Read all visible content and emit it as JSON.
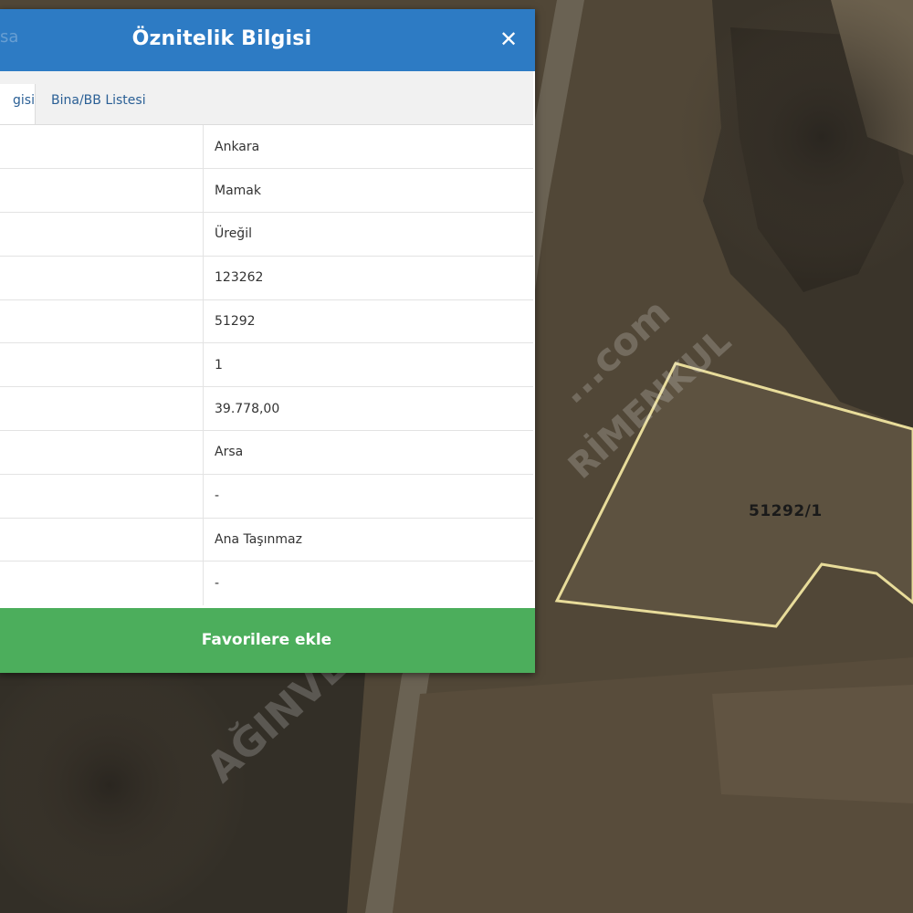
{
  "dialog": {
    "title": "Öznitelik Bilgisi",
    "header_ghost_text": "sa",
    "close_symbol": "✕",
    "tabs": [
      {
        "label": "gisi",
        "active": true
      },
      {
        "label": "Bina/BB Listesi",
        "active": false
      }
    ],
    "rows": [
      {
        "key": "",
        "value": "Ankara"
      },
      {
        "key": "",
        "value": "Mamak"
      },
      {
        "key": "",
        "value": "Üreğil"
      },
      {
        "key": "",
        "value": "123262"
      },
      {
        "key": "",
        "value": "51292"
      },
      {
        "key": "",
        "value": "1"
      },
      {
        "key": "",
        "value": "39.778,00"
      },
      {
        "key": "",
        "value": "Arsa"
      },
      {
        "key": "",
        "value": "-"
      },
      {
        "key": "",
        "value": "Ana Taşınmaz"
      },
      {
        "key": "",
        "value": "-"
      }
    ],
    "favorite_button": "Favorilere ekle"
  },
  "map": {
    "parcel_label": "51292/1",
    "watermark_top": "...com",
    "watermark_mid": "RİMENKUL",
    "watermark_bottom": "AĞINVE"
  },
  "colors": {
    "header": "#2d7bc4",
    "button": "#4cae5c",
    "parcel_outline": "#e8dc9a"
  },
  "icons": {
    "close": "close-icon"
  }
}
